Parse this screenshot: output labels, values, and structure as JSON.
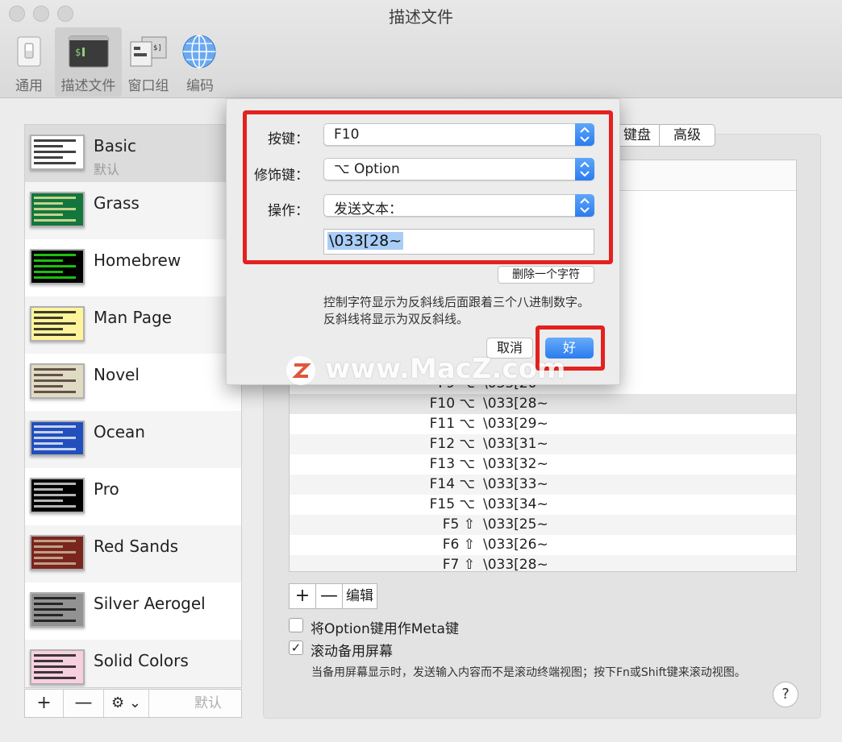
{
  "window": {
    "title": "描述文件"
  },
  "toolbar": {
    "items": [
      {
        "label": "通用",
        "icon": "switch-icon"
      },
      {
        "label": "描述文件",
        "icon": "terminal-icon"
      },
      {
        "label": "窗口组",
        "icon": "window-groups-icon"
      },
      {
        "label": "编码",
        "icon": "globe-icon"
      }
    ]
  },
  "profiles": [
    {
      "name": "Basic",
      "sub": "默认",
      "bg": "#ffffff",
      "fg": "#000000"
    },
    {
      "name": "Grass",
      "bg": "#13773d",
      "fg": "#fff0a5"
    },
    {
      "name": "Homebrew",
      "bg": "#000000",
      "fg": "#28fe14"
    },
    {
      "name": "Man Page",
      "bg": "#fef49c",
      "fg": "#000000"
    },
    {
      "name": "Novel",
      "bg": "#dfdbc3",
      "fg": "#3b2322"
    },
    {
      "name": "Ocean",
      "bg": "#224fbc",
      "fg": "#ffffff"
    },
    {
      "name": "Pro",
      "bg": "#000000",
      "fg": "#f2f2f2"
    },
    {
      "name": "Red Sands",
      "bg": "#7a251e",
      "fg": "#d7c9a7"
    },
    {
      "name": "Silver Aerogel",
      "bg": "#929292",
      "fg": "#000000"
    },
    {
      "name": "Solid Colors",
      "bg": "#f7d0df",
      "fg": "#000000"
    }
  ],
  "list_buttons": {
    "add": "+",
    "remove": "—",
    "gear": "⚙ ⌄",
    "default": "默认"
  },
  "tabs": {
    "keyboard": "键盘",
    "advanced": "高级"
  },
  "key_rows": [
    {
      "key": "F9 ⌥",
      "action": "\\033[20~"
    },
    {
      "key": "F10 ⌥",
      "action": "\\033[28~"
    },
    {
      "key": "F11 ⌥",
      "action": "\\033[29~"
    },
    {
      "key": "F12 ⌥",
      "action": "\\033[31~"
    },
    {
      "key": "F13 ⌥",
      "action": "\\033[32~"
    },
    {
      "key": "F14 ⌥",
      "action": "\\033[33~"
    },
    {
      "key": "F15 ⌥",
      "action": "\\033[34~"
    },
    {
      "key": "F5 ⇧",
      "action": "\\033[25~"
    },
    {
      "key": "F6 ⇧",
      "action": "\\033[26~"
    },
    {
      "key": "F7 ⇧",
      "action": "\\033[28~"
    }
  ],
  "key_buttons": {
    "add": "+",
    "remove": "—",
    "edit": "编辑"
  },
  "options": {
    "meta_label": "将Option键用作Meta键",
    "meta_checked": false,
    "scroll_label": "滚动备用屏幕",
    "scroll_checked": true,
    "scroll_check_mark": "✓",
    "scroll_desc": "当备用屏幕显示时，发送输入内容而不是滚动终端视图；按下Fn或Shift键来滚动视图。"
  },
  "help": "?",
  "sheet": {
    "key_label": "按键：",
    "key_value": "F10",
    "modifier_label": "修饰键：",
    "modifier_value": "⌥ Option",
    "action_label": "操作：",
    "action_value": "发送文本：",
    "text_value": "\\033[28~",
    "delete_char": "删除一个字符",
    "hint": "控制字符显示为反斜线后面跟着三个八进制数字。反斜线将显示为双反斜线。",
    "cancel": "取消",
    "ok": "好",
    "highlight_color": "#e3211f",
    "accent": "#2a7bef"
  },
  "watermark": {
    "text": "www.MacZ.com"
  }
}
